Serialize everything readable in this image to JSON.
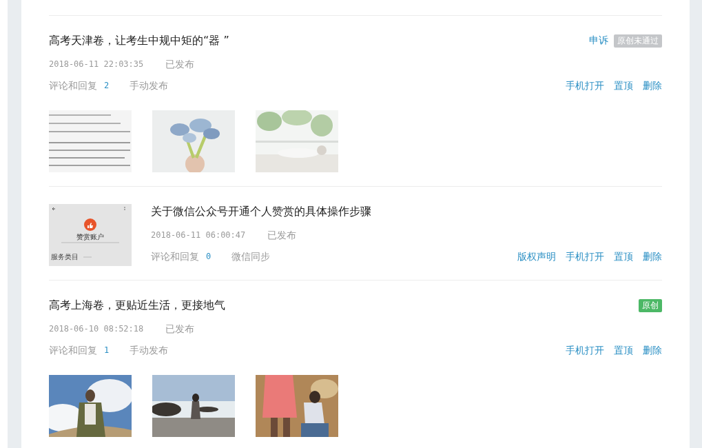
{
  "articles": [
    {
      "kind": "images",
      "title": "高考天津卷，让考生中规中矩的“器 ”",
      "appeal": "申诉",
      "tag": {
        "label": "原创未通过",
        "color": "#c4c6c9"
      },
      "date": "2018-06-11 22:03:35",
      "status": "已发布",
      "comments_label": "评论和回复",
      "comments": "2",
      "source": "手动发布",
      "actions": [
        "手机打开",
        "置顶",
        "删除"
      ],
      "images": [
        {
          "kind": "picture"
        },
        {
          "kind": "picture"
        },
        {
          "kind": "picture"
        }
      ]
    },
    {
      "kind": "thumbnail",
      "thumbnail": {
        "heading": "赞赏账户",
        "footer": "服务类目"
      },
      "title": "关于微信公众号开通个人赞赏的具体操作步骤",
      "date": "2018-06-11 06:00:47",
      "status": "已发布",
      "comments_label": "评论和回复",
      "comments": "0",
      "source": "微信同步",
      "actions": [
        "版权声明",
        "手机打开",
        "置顶",
        "删除"
      ]
    },
    {
      "kind": "images",
      "title": "高考上海卷，更贴近生活，更接地气",
      "tag": {
        "label": "原创",
        "color": "#4cb866"
      },
      "date": "2018-06-10 08:52:18",
      "status": "已发布",
      "comments_label": "评论和回复",
      "comments": "1",
      "source": "手动发布",
      "actions": [
        "手机打开",
        "置顶",
        "删除"
      ],
      "images": [
        {
          "kind": "picture"
        },
        {
          "kind": "picture"
        },
        {
          "kind": "picture"
        }
      ]
    }
  ]
}
